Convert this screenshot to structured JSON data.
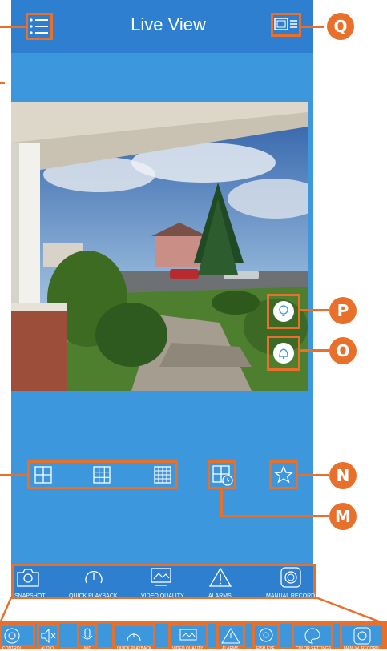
{
  "header": {
    "title": "Live View"
  },
  "callouts": {
    "q": "Q",
    "p": "P",
    "o": "O",
    "n": "N",
    "m": "M"
  },
  "toolbar": {
    "items": [
      {
        "label": "SNAPSHOT",
        "icon": "camera-icon"
      },
      {
        "label": "QUICK PLAYBACK",
        "icon": "playback-icon"
      },
      {
        "label": "VIDEO QUALITY",
        "icon": "video-quality-icon"
      },
      {
        "label": "ALARMS",
        "icon": "alarm-icon"
      },
      {
        "label": "MANUAL RECORD",
        "icon": "record-icon"
      }
    ]
  },
  "strip": {
    "items": [
      {
        "label": "CONTROL",
        "icon": "control-icon"
      },
      {
        "label": "AUDIO",
        "icon": "audio-icon"
      },
      {
        "label": "MIC",
        "icon": "mic-icon"
      },
      {
        "label": "QUICK PLAYBACK",
        "icon": "playback-icon"
      },
      {
        "label": "VIDEO QUALITY",
        "icon": "video-quality-icon"
      },
      {
        "label": "ALARMS",
        "icon": "alarm-icon"
      },
      {
        "label": "FISH EYE",
        "icon": "fisheye-icon"
      },
      {
        "label": "COLOR SETTINGS",
        "icon": "color-settings-icon"
      },
      {
        "label": "MANUAL RECORD",
        "icon": "record-icon"
      }
    ]
  },
  "colors": {
    "accent": "#e8702a",
    "primary": "#3d97dd",
    "header": "#2f7fd1"
  }
}
